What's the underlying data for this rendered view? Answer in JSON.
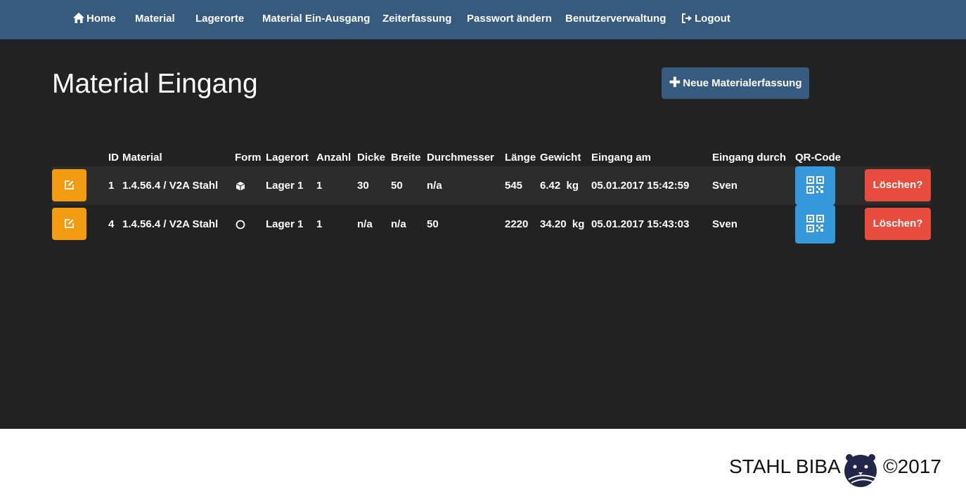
{
  "nav": {
    "home": "Home",
    "material": "Material",
    "lagerorte": "Lagerorte",
    "ein_ausgang": "Material Ein-Ausgang",
    "zeiterfassung": "Zeiterfassung",
    "passwort": "Passwort ändern",
    "benutzer": "Benutzerverwaltung",
    "logout": "Logout"
  },
  "page": {
    "title": "Material Eingang",
    "new_button": "Neue Materialerfassung"
  },
  "table": {
    "headers": {
      "id": "ID",
      "material": "Material",
      "form": "Form",
      "lagerort": "Lagerort",
      "anzahl": "Anzahl",
      "dicke": "Dicke",
      "breite": "Breite",
      "durchmesser": "Durchmesser",
      "laenge": "Länge",
      "gewicht": "Gewicht",
      "eingang_am": "Eingang am",
      "eingang_durch": "Eingang durch",
      "qr": "QR-Code"
    },
    "rows": [
      {
        "id": "1",
        "material": "1.4.56.4 / V2A Stahl",
        "form_icon": "cube-icon",
        "lagerort": "Lager 1",
        "anzahl": "1",
        "dicke": "30",
        "breite": "50",
        "durchmesser": "n/a",
        "laenge": "545",
        "gewicht": "6.42  kg",
        "eingang_am": "05.01.2017 15:42:59",
        "eingang_durch": "Sven",
        "delete_label": "Löschen?"
      },
      {
        "id": "4",
        "material": "1.4.56.4 / V2A Stahl",
        "form_icon": "circle-icon",
        "lagerort": "Lager 1",
        "anzahl": "1",
        "dicke": "n/a",
        "breite": "n/a",
        "durchmesser": "50",
        "laenge": "2220",
        "gewicht": "34.20  kg",
        "eingang_am": "05.01.2017 15:43:03",
        "eingang_durch": "Sven",
        "delete_label": "Löschen?"
      }
    ]
  },
  "footer": {
    "brand": "STAHL BIBA",
    "copyright": "©2017"
  },
  "colors": {
    "navbar": "#375a7f",
    "background": "#222222",
    "edit": "#f39c12",
    "qr": "#3498db",
    "delete": "#e74c3c"
  }
}
